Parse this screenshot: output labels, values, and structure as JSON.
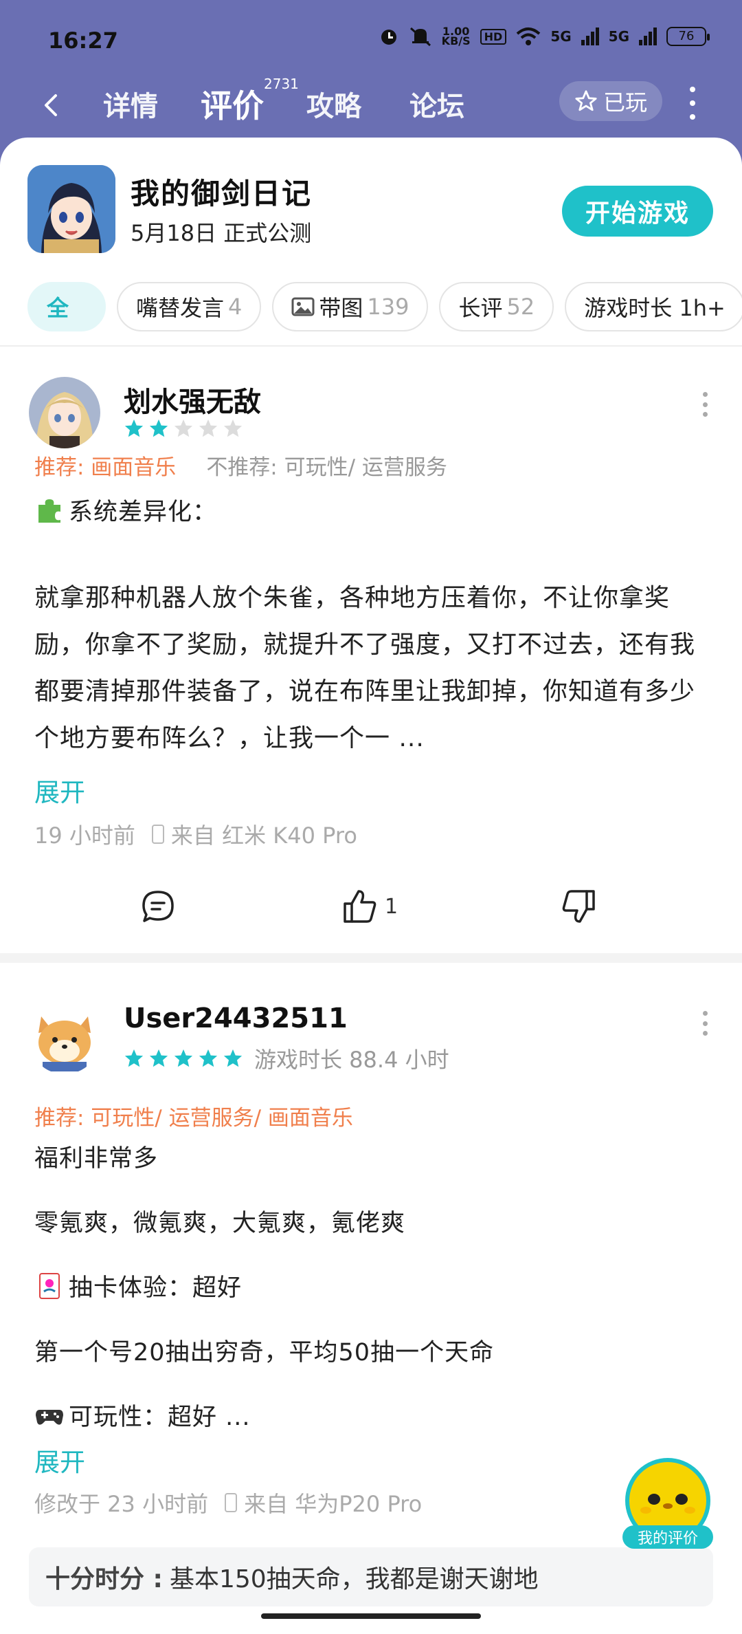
{
  "status_bar": {
    "time": "16:27",
    "net_speed_value": "1.00",
    "net_speed_unit": "KB/S",
    "hd_label": "HD",
    "signal1": "5G",
    "signal2": "5G",
    "battery": "76",
    "icons": [
      "alarm-icon",
      "mute-icon",
      "wifi-icon",
      "signal-icon",
      "battery-icon"
    ]
  },
  "nav": {
    "tabs": [
      {
        "label": "详情",
        "active": false
      },
      {
        "label": "评价",
        "active": true,
        "badge": "2731"
      },
      {
        "label": "攻略",
        "active": false
      },
      {
        "label": "论坛",
        "active": false
      }
    ],
    "played_label": "已玩"
  },
  "game": {
    "title": "我的御剑日记",
    "subtitle": "5月18日 正式公测",
    "start_button": "开始游戏"
  },
  "filters": [
    {
      "label": "全",
      "count": "",
      "active": true
    },
    {
      "label": "嘴替发言",
      "count": "4",
      "active": false
    },
    {
      "label": "带图",
      "count": "139",
      "active": false
    },
    {
      "label": "长评",
      "count": "52",
      "active": false
    },
    {
      "label": "游戏时长 1h+",
      "count": "",
      "active": false
    }
  ],
  "reviews": [
    {
      "username": "划水强无敌",
      "rating": 2,
      "recommend": "推荐: 画面音乐",
      "not_recommend": "不推荐: 可玩性/ 运营服务",
      "heading": "系统差异化：",
      "body": "就拿那种机器人放个朱雀，各种地方压着你，不让你拿奖励，你拿不了奖励，就提升不了强度，又打不过去，还有我都要清掉那件装备了，说在布阵里让我卸掉，你知道有多少个地方要布阵么？，让我一个一 ...",
      "expand": "展开",
      "time": "19 小时前",
      "device": "来自 红米 K40 Pro",
      "likes": "1"
    },
    {
      "username": "User24432511",
      "rating": 5,
      "playtime": "游戏时长 88.4 小时",
      "recommend": "推荐: 可玩性/ 运营服务/ 画面音乐",
      "lines": [
        "福利非常多",
        "零氪爽，微氪爽，大氪爽，氪佬爽",
        "抽卡体验：超好",
        "第一个号20抽出穷奇，平均50抽一个天命",
        "可玩性：超好 ..."
      ],
      "expand": "展开",
      "time": "修改于 23 小时前",
      "device": "来自 华为P20 Pro"
    }
  ],
  "highlight": {
    "key": "十分时分 :",
    "text": "基本150抽天命，我都是谢天谢地"
  },
  "fab_label": "我的评价",
  "colors": {
    "header_bg": "#6a6fb3",
    "accent": "#1fc1c9",
    "recommend": "#f07f4c",
    "muted": "#999999"
  }
}
